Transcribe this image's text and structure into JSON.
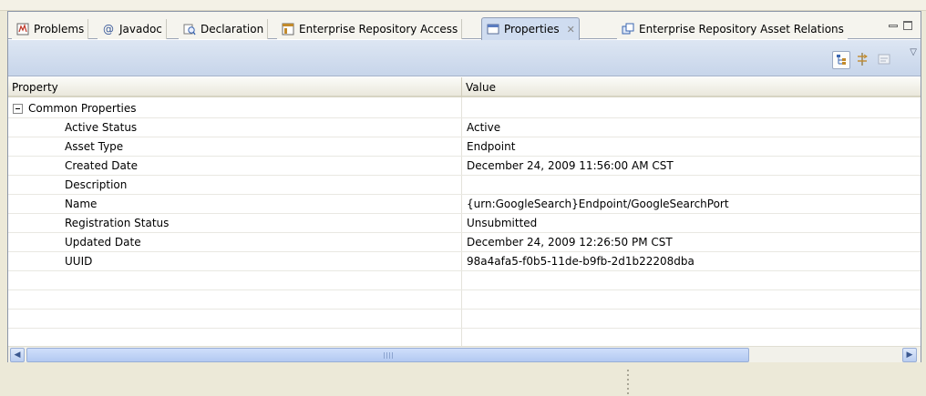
{
  "tabs": [
    {
      "label": "Problems",
      "icon": "problems-icon"
    },
    {
      "label": "Javadoc",
      "icon": "at-icon"
    },
    {
      "label": "Declaration",
      "icon": "declaration-icon"
    },
    {
      "label": "Enterprise Repository Access",
      "icon": "repository-icon"
    },
    {
      "label": "Properties",
      "icon": "properties-icon",
      "active": true,
      "close": "✕"
    },
    {
      "label": "Enterprise Repository Asset Relations",
      "icon": "relations-icon"
    }
  ],
  "table": {
    "headers": {
      "property": "Property",
      "value": "Value"
    },
    "group": {
      "label": "Common Properties",
      "expanded": true
    },
    "rows": [
      {
        "property": "Active Status",
        "value": "Active"
      },
      {
        "property": "Asset Type",
        "value": "Endpoint"
      },
      {
        "property": "Created Date",
        "value": "December 24, 2009 11:56:00 AM CST"
      },
      {
        "property": "Description",
        "value": ""
      },
      {
        "property": "Name",
        "value": "{urn:GoogleSearch}Endpoint/GoogleSearchPort"
      },
      {
        "property": "Registration Status",
        "value": "Unsubmitted"
      },
      {
        "property": "Updated Date",
        "value": "December 24, 2009 12:26:50 PM CST"
      },
      {
        "property": "UUID",
        "value": "98a4afa5-f0b5-11de-b9fb-2d1b22208dba"
      }
    ]
  },
  "toolbar": {
    "buttons": [
      "show-categories-icon",
      "show-advanced-icon",
      "restore-default-icon"
    ]
  },
  "colors": {
    "accent": "#cfdcf0",
    "toolbar": "#c7d5ea",
    "scroll": "#b3c9f1"
  }
}
